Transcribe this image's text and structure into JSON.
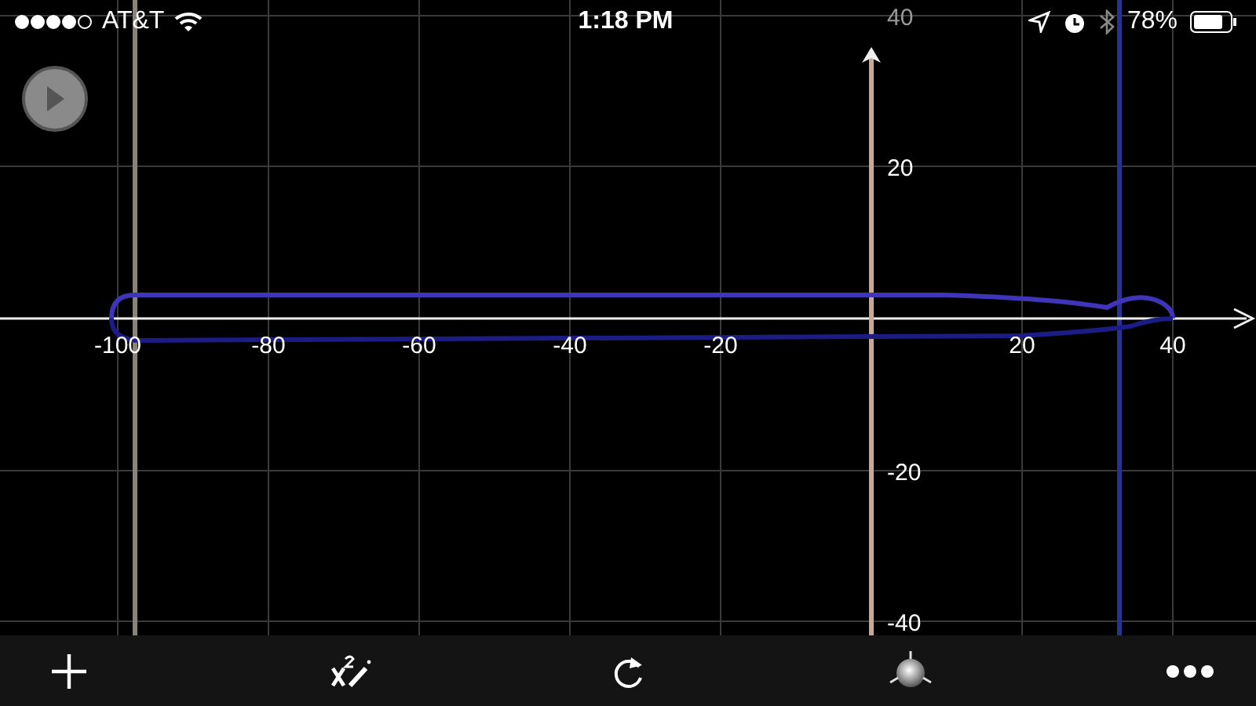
{
  "status_bar": {
    "carrier": "AT&T",
    "time": "1:18 PM",
    "battery": "78%"
  },
  "graph": {
    "x_ticks": [
      "-100",
      "-80",
      "-60",
      "-40",
      "-20",
      "20",
      "40"
    ],
    "y_ticks": [
      "40",
      "20",
      "-20",
      "-40"
    ]
  },
  "toolbar": [
    {
      "kind": "add"
    },
    {
      "kind": "equation"
    },
    {
      "kind": "redo"
    },
    {
      "kind": "light"
    },
    {
      "kind": "more"
    }
  ]
}
